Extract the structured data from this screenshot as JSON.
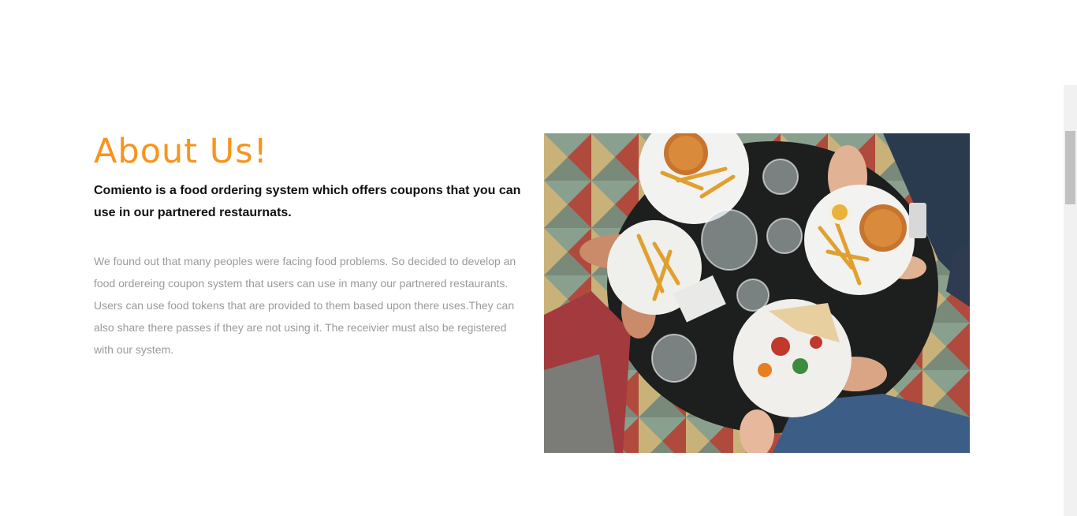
{
  "about": {
    "title": "About Us!",
    "lead": "Comiento is a food ordering system which offers coupons that you can use in our partnered restaurnats.",
    "body": "We found out that many peoples were facing food problems. So decided to develop an food ordereing coupon system that users can use in many our partnered restaurants. Users can use food tokens that are provided to them based upon there uses.They can also share there passes if they are not using it. The receivier must also be registered with our system.",
    "image_alt": "Top view of friends eating burgers and fries at a table"
  },
  "colors": {
    "accent": "#f7941d",
    "lead_text": "#111111",
    "body_text": "#9a9a9a"
  }
}
